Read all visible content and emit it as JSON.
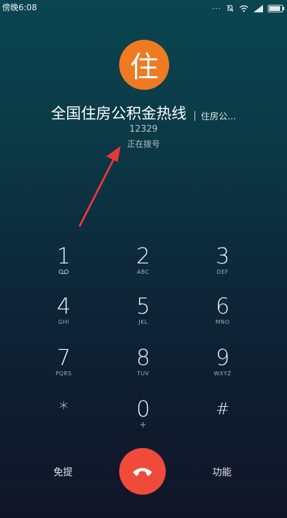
{
  "status_bar": {
    "time": "傍晚6:08",
    "icons": [
      "more-dots-icon",
      "mute-bell-icon",
      "wifi-icon",
      "signal-icon",
      "battery-icon"
    ],
    "more_dots": "···"
  },
  "caller": {
    "avatar_char": "住",
    "name": "全国住房公积金热线",
    "tag": "住房公...",
    "number": "12329",
    "status": "正在拨号"
  },
  "keypad": [
    {
      "digit": "1",
      "letters": "",
      "icon": "voicemail-icon"
    },
    {
      "digit": "2",
      "letters": "ABC"
    },
    {
      "digit": "3",
      "letters": "DEF"
    },
    {
      "digit": "4",
      "letters": "GHI"
    },
    {
      "digit": "5",
      "letters": "JKL"
    },
    {
      "digit": "6",
      "letters": "MNO"
    },
    {
      "digit": "7",
      "letters": "PQRS"
    },
    {
      "digit": "8",
      "letters": "TUV"
    },
    {
      "digit": "9",
      "letters": "WXYZ"
    },
    {
      "digit": "*",
      "letters": ""
    },
    {
      "digit": "0",
      "letters": "+"
    },
    {
      "digit": "#",
      "letters": ""
    }
  ],
  "actions": {
    "speaker_label": "免提",
    "more_label": "功能"
  },
  "colors": {
    "avatar": "#ef7a22",
    "hangup": "#f04a3a",
    "arrow": "#e8363a"
  }
}
